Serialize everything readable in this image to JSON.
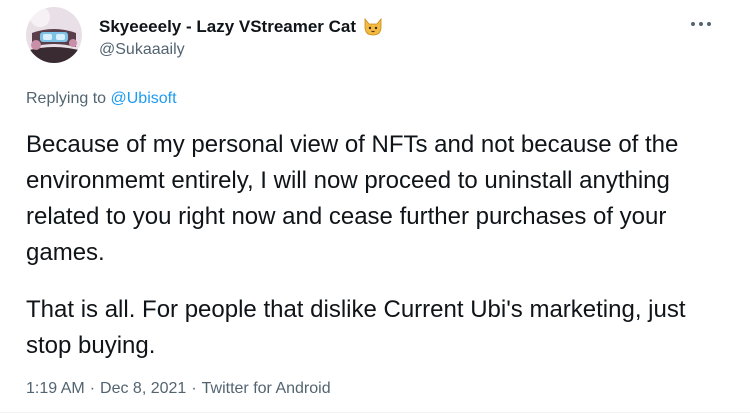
{
  "tweet": {
    "author": {
      "display_name": "Skyeeeely - Lazy VStreamer Cat",
      "name_emoji_icon": "cat-face-emoji",
      "handle": "@Sukaaaily"
    },
    "more_icon": "more-horizontal-icon",
    "reply_context": {
      "prefix": "Replying to",
      "mention": "@Ubisoft"
    },
    "paragraphs": [
      "Because of my personal view of NFTs and not because of the environmemt entirely, I will now proceed to uninstall anything related to you right now and cease further purchases of your games.",
      "That is all. For people that dislike Current Ubi's marketing, just stop buying."
    ],
    "meta": {
      "time": "1:19 AM",
      "separator": "·",
      "date": "Dec 8, 2021",
      "source": "Twitter for Android"
    }
  },
  "colors": {
    "text_primary": "#0f1419",
    "text_secondary": "#536471",
    "link": "#1d9bf0",
    "background": "#ffffff"
  }
}
